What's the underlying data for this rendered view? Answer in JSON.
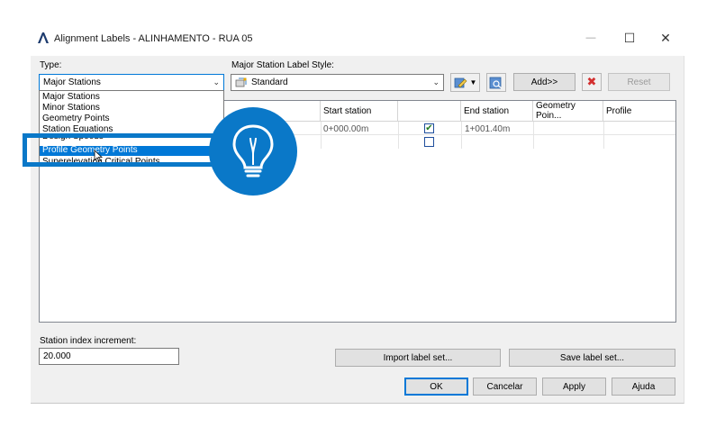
{
  "window": {
    "title": "Alignment Labels - ALINHAMENTO - RUA 05",
    "minimize": "—",
    "maximize": "☐",
    "close": "✕"
  },
  "type_section": {
    "label": "Type:",
    "selected": "Major Stations",
    "options": [
      "Major Stations",
      "Minor Stations",
      "Geometry Points",
      "Station Equations",
      "Design Speeds",
      "Profile Geometry Points",
      "Superelevation Critical Points"
    ],
    "highlighted_option": "Profile Geometry Points"
  },
  "style_section": {
    "label": "Major Station Label Style:",
    "selected": "Standard"
  },
  "toolbar": {
    "add_label": "Add>>",
    "reset_label": "Reset"
  },
  "grid": {
    "columns": [
      "Start station",
      "End station",
      "Geometry Poin...",
      "Profile"
    ],
    "rows": [
      {
        "start": "0+000.00m",
        "end": "1+001.40m",
        "checked": true
      }
    ]
  },
  "station_index": {
    "label": "Station index increment:",
    "value": "20.000"
  },
  "buttons": {
    "import": "Import label set...",
    "save": "Save label set...",
    "ok": "OK",
    "cancel": "Cancelar",
    "apply": "Apply",
    "help": "Ajuda"
  },
  "colors": {
    "highlight_blue": "#0a78c8",
    "selection_blue": "#0078d7"
  },
  "overlay": {
    "icon": "lightbulb-icon"
  }
}
